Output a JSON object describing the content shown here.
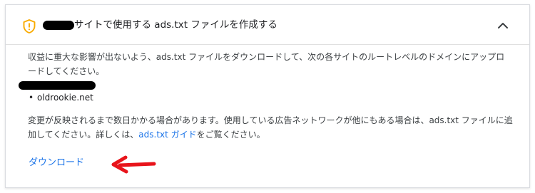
{
  "header": {
    "title": "サイトで使用する ads.txt ファイルを作成する",
    "warning_icon": "warning-shield-icon",
    "collapse_icon": "chevron-up-icon",
    "accent_color": "#f9ab00"
  },
  "intro_text": "収益に重大な影響が出ないよう、ads.txt ファイルをダウンロードして、次の各サイトのルートレベルのドメインにアップロードしてください。",
  "sites": [
    "oldrookie.net"
  ],
  "note": {
    "text_before": "変更が反映されるまで数日かかる場合があります。使用している広告ネットワークが他にもある場合は、ads.txt ファイルに追加してください。詳しくは、",
    "link": "ads.txt ガイド",
    "text_after": "をご覧ください。"
  },
  "actions": {
    "download_label": "ダウンロード"
  },
  "annotation": {
    "arrow_icon": "red-arrow-left-icon",
    "color": "#e8141b"
  },
  "colors": {
    "link": "#1a73e8",
    "border": "#dadce0"
  }
}
